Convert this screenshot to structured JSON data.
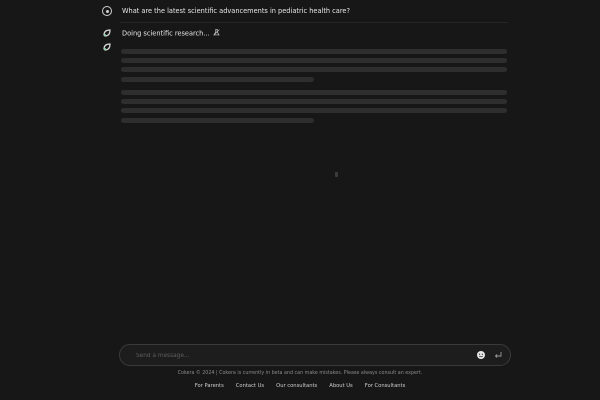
{
  "conversation": {
    "user_message": "What are the latest scientific advancements in pediatric health care?",
    "assistant_status": "Doing scientific research..."
  },
  "icons": {
    "user_avatar": "user-circle-icon",
    "assistant_avatar": "cokera-leaf-logo-icon",
    "status_spinner": "flask-research-icon",
    "attach": "smile-face-icon",
    "send": "enter-return-icon"
  },
  "composer": {
    "placeholder": "Send a message..."
  },
  "footer": {
    "note": "Cokera © 2024 | Cokera is currently in beta and can make mistakes. Please always consult an expert.",
    "links": [
      "For Parents",
      "Contact Us",
      "Our consultants",
      "About Us",
      "For Consultants"
    ]
  },
  "colors": {
    "background": "#171717",
    "skeleton": "#2e2e2e",
    "accent_green": "#7fd6a6",
    "text": "#e8e8e8"
  }
}
